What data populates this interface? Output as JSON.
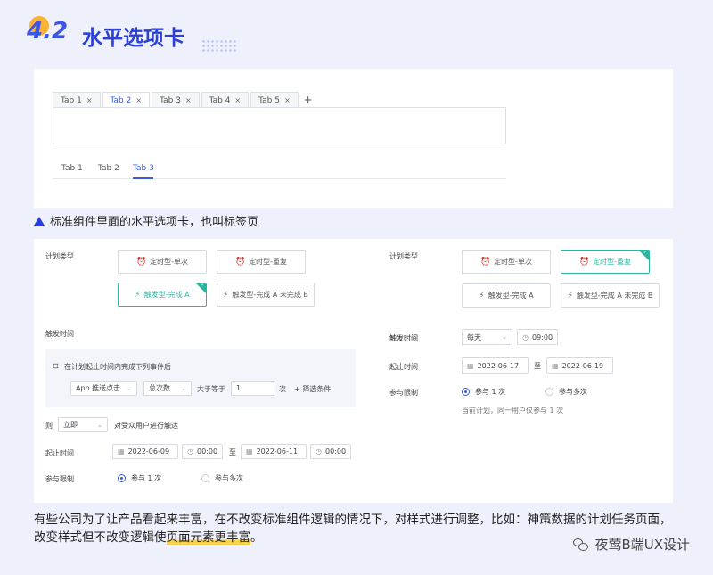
{
  "header": {
    "number": "4.2",
    "title": "水平选项卡"
  },
  "section1": {
    "card_tabs": [
      {
        "label": "Tab 1",
        "active": false
      },
      {
        "label": "Tab 2",
        "active": true
      },
      {
        "label": "Tab 3",
        "active": false
      },
      {
        "label": "Tab 4",
        "active": false
      },
      {
        "label": "Tab 5",
        "active": false
      }
    ],
    "close_glyph": "×",
    "add_glyph": "+",
    "line_tabs": [
      {
        "label": "Tab 1",
        "active": false
      },
      {
        "label": "Tab 2",
        "active": false
      },
      {
        "label": "Tab 3",
        "active": true
      }
    ]
  },
  "caption": "标准组件里面的水平选项卡，也叫标签页",
  "left_form": {
    "plan_type_label": "计划类型",
    "plan_cards": [
      "定时型-单次",
      "定时型-重复",
      "触发型-完成 A",
      "触发型-完成 A 未完成 B"
    ],
    "selected_index": 2,
    "trigger_time_label": "触发时间",
    "condition_title": "在计划起止时间内完成下列事件后",
    "event_select": "App 推送点击",
    "metric_select": "总次数",
    "compare_text": "大于等于",
    "count_value": "1",
    "count_unit": "次",
    "filter_label": "筛选条件",
    "then_label": "则",
    "then_select": "立即",
    "then_text": "对受众用户进行触达",
    "range_label": "起止时间",
    "start_date": "2022-06-09",
    "start_time": "00:00",
    "to_text": "至",
    "end_date": "2022-06-11",
    "end_time": "00:00",
    "limit_label": "参与限制",
    "limit_once": "参与 1 次",
    "limit_many": "参与多次"
  },
  "right_form": {
    "plan_type_label": "计划类型",
    "plan_cards": [
      "定时型-单次",
      "定时型-重复",
      "触发型-完成 A",
      "触发型-完成 A 未完成 B"
    ],
    "selected_index": 1,
    "trigger_time_label": "触发时间",
    "freq_select": "每天",
    "time_value": "09:00",
    "range_label": "起止时间",
    "start_date": "2022-06-17",
    "to_text": "至",
    "end_date": "2022-06-19",
    "limit_label": "参与限制",
    "limit_once": "参与 1 次",
    "limit_many": "参与多次",
    "limit_hint": "当前计划，同一用户仅参与 1 次"
  },
  "footer": {
    "line1": "有些公司为了让产品看起来丰富，在不改变标准组件逻辑的情况下，对样式进行调整，比如：神策数据的计划任务页面，",
    "line2_a": "改变样式但不改变逻辑使",
    "line2_hl": "页面元素更丰富",
    "line2_b": "。"
  },
  "brand": "夜莺B端UX设计",
  "colors": {
    "accent": "#3b5bdb",
    "selected_teal": "#2bb5a0",
    "title_blue": "#2a40d6",
    "background": "#eef0fb"
  }
}
